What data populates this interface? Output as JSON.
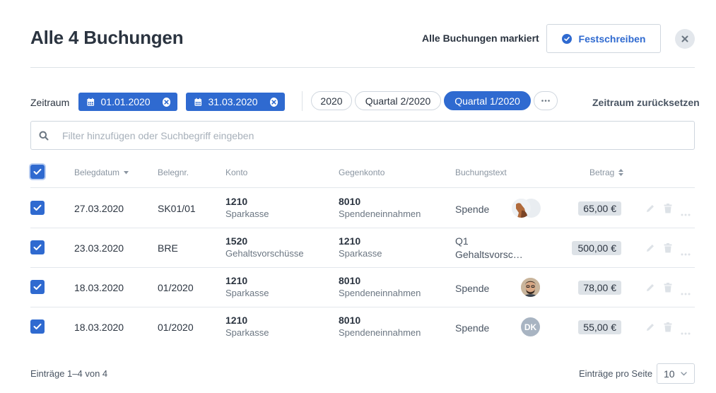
{
  "header": {
    "title": "Alle 4 Buchungen",
    "marked_text": "Alle Buchungen markiert",
    "commit_label": "Festschreiben",
    "close_icon": "close-icon"
  },
  "filters": {
    "zeitraum_label": "Zeitraum",
    "date_from": "01.01.2020",
    "date_to": "31.03.2020",
    "periods": [
      "2020",
      "Quartal 2/2020",
      "Quartal 1/2020"
    ],
    "active_period": "Quartal 1/2020",
    "more_label": "···",
    "reset_label": "Zeitraum zurücksetzen"
  },
  "search": {
    "placeholder": "Filter hinzufügen oder Suchbegriff eingeben",
    "value": ""
  },
  "table": {
    "columns": {
      "belegdatum": "Belegdatum",
      "belegnr": "Belegnr.",
      "konto": "Konto",
      "gegenkonto": "Gegenkonto",
      "buchungstext": "Buchungstext",
      "betrag": "Betrag"
    },
    "rows": [
      {
        "checked": true,
        "date": "27.03.2020",
        "nr": "SK01/01",
        "konto": "1210",
        "konto_name": "Sparkasse",
        "gegen": "8010",
        "gegen_name": "Spendeneinnahmen",
        "text": "Spende",
        "text2": "",
        "amount": "65,00 €",
        "avatar": "photo-group"
      },
      {
        "checked": true,
        "date": "23.03.2020",
        "nr": "BRE",
        "konto": "1520",
        "konto_name": "Gehaltsvorschüsse",
        "gegen": "1210",
        "gegen_name": "Sparkasse",
        "text": "Q1",
        "text2": "Gehaltsvorsc…",
        "amount": "500,00 €",
        "avatar": ""
      },
      {
        "checked": true,
        "date": "18.03.2020",
        "nr": "01/2020",
        "konto": "1210",
        "konto_name": "Sparkasse",
        "gegen": "8010",
        "gegen_name": "Spendeneinnahmen",
        "text": "Spende",
        "text2": "",
        "amount": "78,00 €",
        "avatar": "photo"
      },
      {
        "checked": true,
        "date": "18.03.2020",
        "nr": "01/2020",
        "konto": "1210",
        "konto_name": "Sparkasse",
        "gegen": "8010",
        "gegen_name": "Spendeneinnahmen",
        "text": "Spende",
        "text2": "",
        "amount": "55,00 €",
        "avatar": "DK"
      }
    ]
  },
  "footer": {
    "count_text": "Einträge 1–4 von 4",
    "per_page_label": "Einträge pro Seite",
    "per_page_value": "10"
  },
  "colors": {
    "accent": "#2f6ad0",
    "text": "#2b3440",
    "muted": "#8a95a1",
    "amount_bg": "#dde2e7"
  }
}
